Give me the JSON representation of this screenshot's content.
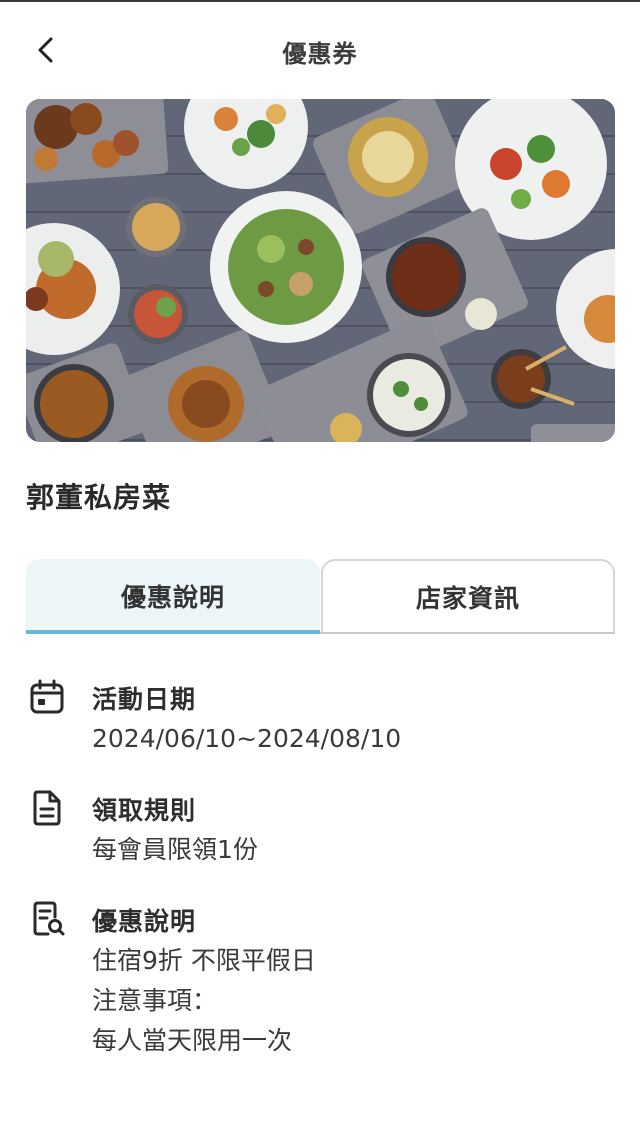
{
  "header": {
    "title": "優惠券",
    "back_icon": "chevron-left-icon"
  },
  "hero": {
    "image": "food-spread-photo"
  },
  "store": {
    "name": "郭董私房菜"
  },
  "tabs": [
    {
      "label": "優惠說明",
      "active": true
    },
    {
      "label": "店家資訊",
      "active": false
    }
  ],
  "colors": {
    "tab_active_bg": "#ecf6f9",
    "tab_underline": "#6ab8cf"
  },
  "sections": {
    "date": {
      "icon": "calendar-icon",
      "title": "活動日期",
      "lines": [
        "2024/06/10~2024/08/10"
      ]
    },
    "rules": {
      "icon": "document-icon",
      "title": "領取規則",
      "lines": [
        "每會員限領1份"
      ]
    },
    "offer": {
      "icon": "document-search-icon",
      "title": "優惠說明",
      "lines": [
        "住宿9折 不限平假日",
        "注意事項：",
        "每人當天限用一次"
      ]
    }
  }
}
